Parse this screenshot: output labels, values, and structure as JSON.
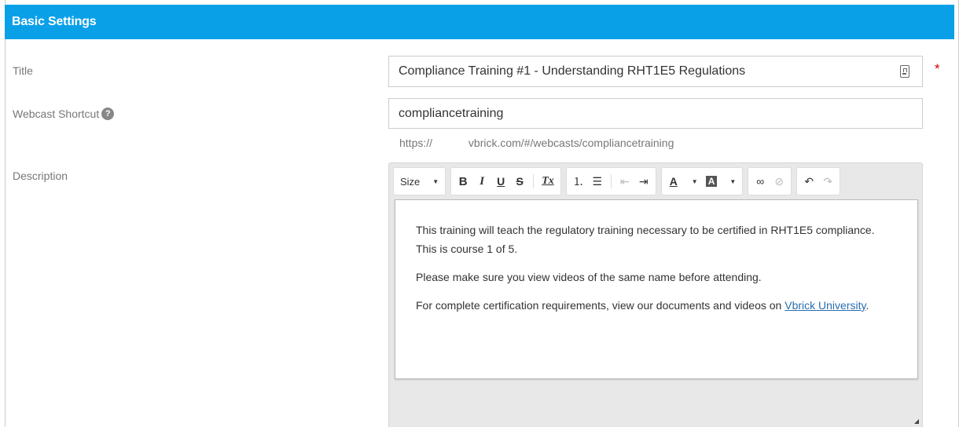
{
  "header": {
    "title": "Basic Settings"
  },
  "form": {
    "title_label": "Title",
    "title_value": "Compliance Training #1 - Understanding RHT1E5 Regulations",
    "required_mark": "*",
    "shortcut_label": "Webcast Shortcut",
    "help_glyph": "?",
    "shortcut_value": "compliancetraining",
    "shortcut_url": "https://    vbrick.com/#/webcasts/compliancetraining",
    "description_label": "Description"
  },
  "editor": {
    "toolbar": {
      "size_label": "Size",
      "size_caret": "▼",
      "bold": "B",
      "italic": "I",
      "underline": "U",
      "strike": "S",
      "clear_format": "Tx",
      "ordered_list": "⒈",
      "bullet_list": "☰",
      "outdent": "⇤",
      "indent": "⇥",
      "text_color": "A",
      "bg_color": "A",
      "link": "∞",
      "unlink": "⊘",
      "undo": "↶",
      "redo": "↷"
    },
    "content": {
      "paragraph1": "This training will teach the regulatory training necessary to be certified in RHT1E5 compliance.  This is course 1 of 5.",
      "paragraph2": "Please make sure you view videos of the same name before attending.",
      "paragraph3_text": "For complete certification requirements, view our documents and videos on ",
      "paragraph3_link": "Vbrick University",
      "paragraph3_end": "."
    }
  },
  "colors": {
    "header_bg": "#0aa0e8",
    "required": "#cc0000",
    "link": "#2a6db0"
  }
}
